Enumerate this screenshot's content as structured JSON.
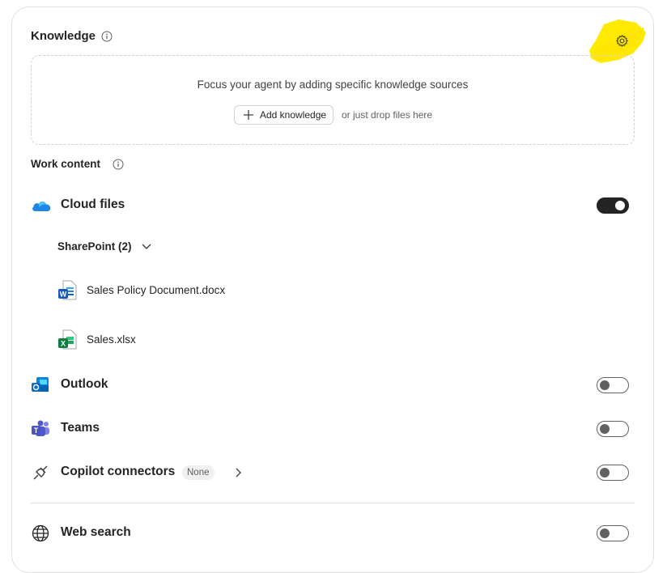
{
  "knowledge": {
    "title": "Knowledge",
    "info_icon": "info-icon",
    "settings_icon": "gear-icon",
    "highlight_color": "#ffea00"
  },
  "dropzone": {
    "prompt": "Focus your agent by adding specific knowledge sources",
    "add_button_label": "Add knowledge",
    "alt_text": "or just drop files here"
  },
  "work_content": {
    "title": "Work content",
    "cloud_files": {
      "label": "Cloud files",
      "toggle": "on",
      "sharepoint": {
        "label": "SharePoint (2)",
        "files": [
          {
            "name": "Sales Policy Document.docx",
            "icon": "word-file-icon"
          },
          {
            "name": "Sales.xlsx",
            "icon": "excel-file-icon"
          }
        ]
      }
    },
    "outlook": {
      "label": "Outlook",
      "toggle": "off"
    },
    "teams": {
      "label": "Teams",
      "toggle": "off"
    },
    "connectors": {
      "label": "Copilot connectors",
      "badge": "None",
      "toggle": "off"
    }
  },
  "web_search": {
    "label": "Web search",
    "toggle": "off"
  },
  "colors": {
    "toggle_on": "#242424",
    "toggle_off_border": "#616161"
  }
}
